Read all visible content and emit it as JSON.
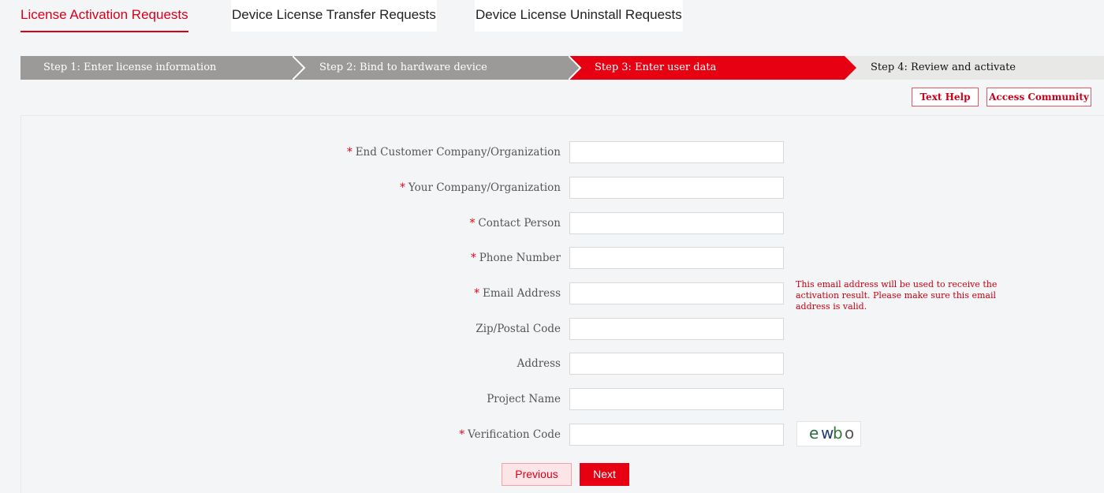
{
  "tabs": {
    "activation": "License Activation Requests",
    "transfer": "Device License Transfer Requests",
    "uninstall": "Device License Uninstall Requests"
  },
  "steps": [
    "Step 1: Enter license information",
    "Step 2: Bind to hardware device",
    "Step 3: Enter user data",
    "Step 4: Review and activate"
  ],
  "current_step": 3,
  "help": {
    "text_help": "Text Help",
    "access_community": "Access Community"
  },
  "form": {
    "required_marker": "*",
    "fields": {
      "end_customer": {
        "label": "End Customer Company/Organization",
        "value": ""
      },
      "your_company": {
        "label": "Your Company/Organization",
        "value": ""
      },
      "contact_person": {
        "label": "Contact Person",
        "value": ""
      },
      "phone": {
        "label": "Phone Number",
        "value": ""
      },
      "email": {
        "label": "Email Address",
        "value": ""
      },
      "zip": {
        "label": "Zip/Postal Code",
        "value": ""
      },
      "address": {
        "label": "Address",
        "value": ""
      },
      "project": {
        "label": "Project Name",
        "value": ""
      },
      "verification": {
        "label": "Verification Code",
        "value": ""
      }
    },
    "email_note": "This email address will be used to receive the activation result. Please make sure this email address is valid.",
    "captcha_text": "ewbo"
  },
  "buttons": {
    "previous": "Previous",
    "next": "Next"
  },
  "colors": {
    "accent": "#e60012",
    "step_inactive": "#9b9a99",
    "step_pending": "#e8e8e6"
  }
}
